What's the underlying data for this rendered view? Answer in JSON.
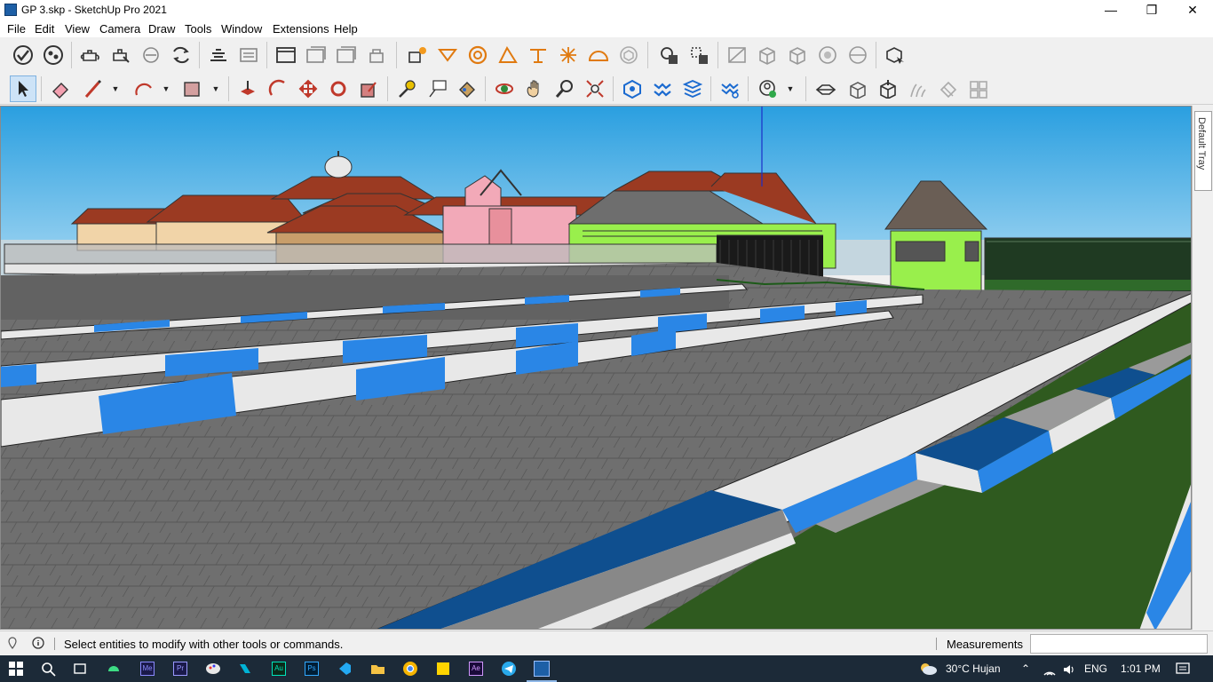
{
  "window": {
    "title": "GP 3.skp - SketchUp Pro 2021",
    "minimize_glyph": "—",
    "maximize_glyph": "❐",
    "close_glyph": "✕"
  },
  "menu": [
    "File",
    "Edit",
    "View",
    "Camera",
    "Draw",
    "Tools",
    "Window",
    "Extensions",
    "Help"
  ],
  "toolbar_top": {
    "icons": [
      "extension-warehouse-icon",
      "trimble-connect-icon",
      "component-icon",
      "teapot-materials-icon",
      "teapot-paint-icon",
      "teapot-rotate-icon",
      "layout-send-icon",
      "generate-report-icon",
      "outliner-icon",
      "window-view-icon",
      "scene-icon",
      "lock-icon",
      "shadows-icon",
      "section-plane-icon",
      "follow-me-icon",
      "scale-skew-icon",
      "eraser-axes-icon",
      "explode-icon",
      "dome-icon",
      "solid-icon",
      "outer-shell-icon",
      "intersect-icon",
      "xray-icon",
      "back-edges-icon",
      "wireframe-icon",
      "hidden-line-icon",
      "shaded-icon",
      "shaded-textures-icon",
      "monochrome-icon",
      "preview-icon"
    ]
  },
  "toolbar_bottom": {
    "icons": [
      "select-icon",
      "eraser-icon",
      "line-icon",
      "arc-icon",
      "rectangle-icon",
      "push-pull-icon",
      "offset-icon",
      "move-icon",
      "rotate-icon",
      "scale-icon",
      "tape-measure-icon",
      "text-icon",
      "paint-bucket-icon",
      "orbit-icon",
      "pan-icon",
      "zoom-icon",
      "zoom-extents-icon",
      "warehouse-3d-icon",
      "sandbox-icon",
      "stamp-icon",
      "drape-icon",
      "profile-icon",
      "section-icon",
      "box-icon",
      "component-add-icon",
      "flip-icon",
      "bend-icon",
      "grid-icon"
    ]
  },
  "tray": {
    "label": "Default Tray"
  },
  "status": {
    "message": "Select entities to modify with other tools or commands.",
    "measurements_label": "Measurements",
    "measurements_value": ""
  },
  "taskbar": {
    "weather": "30°C  Hujan",
    "lang": "ENG",
    "time": "1:01 PM",
    "apps": [
      "windows-start-icon",
      "search-icon",
      "task-view-icon",
      "android-icon",
      "media-encoder-icon",
      "premiere-icon",
      "paint-icon",
      "sourcetree-icon",
      "audition-icon",
      "photoshop-icon",
      "vscode-icon",
      "file-explorer-icon",
      "chrome-icon",
      "sticky-notes-icon",
      "after-effects-icon",
      "telegram-icon",
      "sketchup-icon"
    ]
  },
  "colors": {
    "sky_top": "#2a9fe0",
    "sky_bottom": "#9ed4f1",
    "paving": "#6f6f6f",
    "curb_blue": "#2a86e6",
    "curb_white": "#ececec",
    "grass": "#2f5a1f",
    "roof": "#9b3a22",
    "lime": "#99ef4c",
    "pink": "#f2a9b8"
  }
}
